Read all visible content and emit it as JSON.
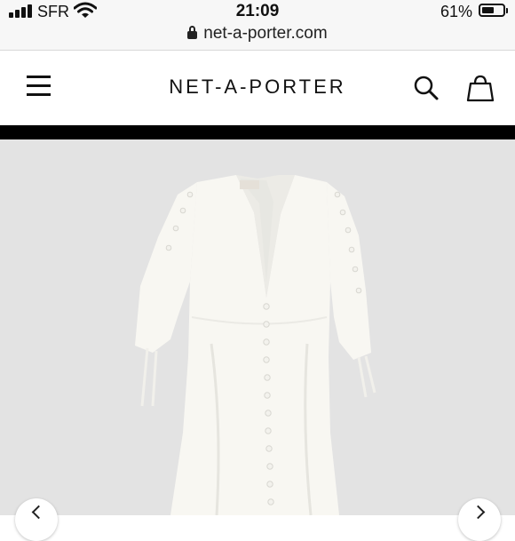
{
  "status_bar": {
    "carrier": "SFR",
    "time": "21:09",
    "battery_percent": "61%",
    "battery_level": 0.61
  },
  "browser": {
    "url": "net-a-porter.com"
  },
  "header": {
    "logo": "NET-A-PORTER",
    "icons": {
      "menu": "hamburger-menu-icon",
      "search": "search-icon",
      "bag": "shopping-bag-icon"
    }
  },
  "product": {
    "dress_color": "#f8f7f2",
    "background_color": "#e3e3e3",
    "carousel": {
      "prev_icon": "chevron-left-icon",
      "next_icon": "chevron-right-icon"
    }
  }
}
